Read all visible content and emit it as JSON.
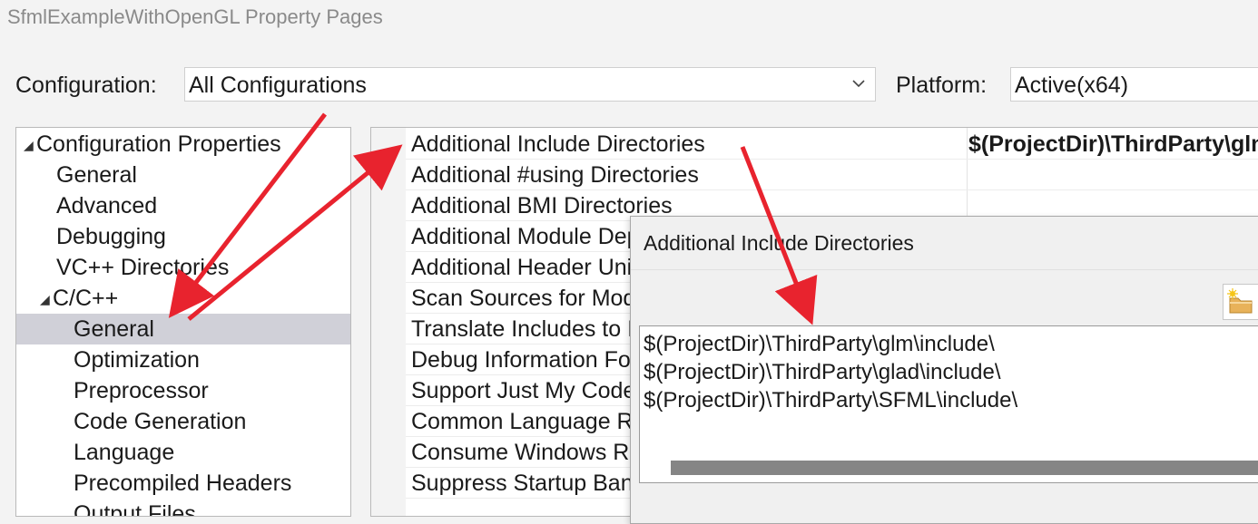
{
  "window": {
    "title": "SfmlExampleWithOpenGL Property Pages"
  },
  "toolbar": {
    "configuration_label": "Configuration:",
    "configuration_value": "All Configurations",
    "platform_label": "Platform:",
    "platform_value": "Active(x64)"
  },
  "tree": {
    "items": [
      {
        "label": "Configuration Properties",
        "expander": "◢"
      },
      {
        "label": "General"
      },
      {
        "label": "Advanced"
      },
      {
        "label": "Debugging"
      },
      {
        "label": "VC++ Directories"
      },
      {
        "label": "C/C++",
        "expander": "◢"
      },
      {
        "label": "General"
      },
      {
        "label": "Optimization"
      },
      {
        "label": "Preprocessor"
      },
      {
        "label": "Code Generation"
      },
      {
        "label": "Language"
      },
      {
        "label": "Precompiled Headers"
      },
      {
        "label": "Output Files"
      }
    ]
  },
  "grid": {
    "rows": [
      {
        "name": "Additional Include Directories",
        "value": "$(ProjectDir)\\ThirdParty\\glm\\include\\;$(ProjectDir)\\ThirdParty\\glad\\include\\;$(ProjectDir)\\ThirdParty\\SFML\\include\\"
      },
      {
        "name": "Additional #using Directories"
      },
      {
        "name": "Additional BMI Directories"
      },
      {
        "name": "Additional Module Dependencies"
      },
      {
        "name": "Additional Header Unit Dependencies"
      },
      {
        "name": "Scan Sources for Module Dependencies"
      },
      {
        "name": "Translate Includes to Imports"
      },
      {
        "name": "Debug Information Format"
      },
      {
        "name": "Support Just My Code Debugging"
      },
      {
        "name": "Common Language RunTime Support"
      },
      {
        "name": "Consume Windows Runtime Extension"
      },
      {
        "name": "Suppress Startup Banner"
      }
    ]
  },
  "dialog": {
    "title": "Additional Include Directories",
    "new_line_icon": "folder-new-icon",
    "paths": [
      "$(ProjectDir)\\ThirdParty\\glm\\include\\",
      "$(ProjectDir)\\ThirdParty\\glad\\include\\",
      "$(ProjectDir)\\ThirdParty\\SFML\\include\\"
    ]
  },
  "colors": {
    "annotation_arrow": "#e8232e",
    "selection": "#d0d0d8",
    "scrollbar": "#858585"
  }
}
